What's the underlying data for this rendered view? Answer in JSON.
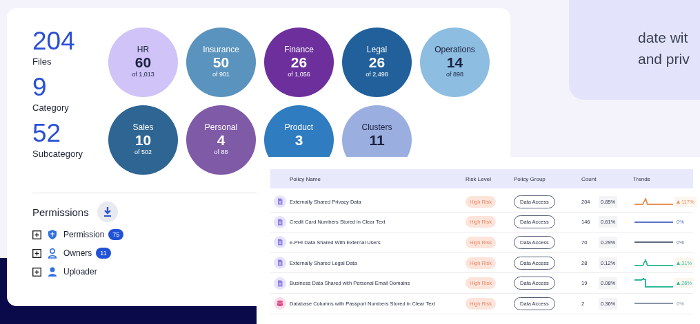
{
  "summary": {
    "stats": [
      {
        "value": "204",
        "label": "Files"
      },
      {
        "value": "9",
        "label": "Category"
      },
      {
        "value": "52",
        "label": "Subcategory"
      }
    ],
    "categories": [
      {
        "name": "HR",
        "count": "60",
        "of": "of 1,013",
        "color": "#cfc3f7",
        "dark_text": true
      },
      {
        "name": "Insurance",
        "count": "50",
        "of": "of 901",
        "color": "#5a93bd",
        "dark_text": false
      },
      {
        "name": "Finance",
        "count": "26",
        "of": "of 1,056",
        "color": "#6d2f9c",
        "dark_text": false
      },
      {
        "name": "Legal",
        "count": "26",
        "of": "of 2,498",
        "color": "#21609a",
        "dark_text": false
      },
      {
        "name": "Operations",
        "count": "14",
        "of": "of 898",
        "color": "#8dbde0",
        "dark_text": true
      },
      {
        "name": "Sales",
        "count": "10",
        "of": "of 502",
        "color": "#2f6592",
        "dark_text": false
      },
      {
        "name": "Personal",
        "count": "4",
        "of": "of 88",
        "color": "#7f5aa6",
        "dark_text": false
      },
      {
        "name": "Product",
        "count": "3",
        "color": "#2f7cc0",
        "dark_text": false
      },
      {
        "name": "Clusters",
        "count": "11",
        "color": "#9aaee0",
        "dark_text": true
      }
    ]
  },
  "permissions": {
    "title": "Permissions",
    "items": [
      {
        "label": "Permission",
        "kind": "shield",
        "badge": "75",
        "expanded": false
      },
      {
        "label": "Owners",
        "kind": "person-outline",
        "badge": "11",
        "expanded": false
      },
      {
        "label": "Uploader",
        "kind": "person",
        "expanded": false
      }
    ]
  },
  "side_card": {
    "lines": [
      "date wit",
      "and priv"
    ]
  },
  "table": {
    "columns": [
      "Policy Name",
      "Risk Level",
      "Policy Group",
      "Count",
      "Trends"
    ],
    "rows": [
      {
        "kind": "document",
        "name": "Externally Shared Privacy Data",
        "risk": "High Risk",
        "group": "Data Access",
        "count": "204",
        "share": "0.85%",
        "rising": true,
        "change": "117%",
        "color": "#e8935a"
      },
      {
        "kind": "document",
        "name": "Credit Card Numbers Stored in Clear Text",
        "risk": "High Risk",
        "group": "Data Access",
        "count": "146",
        "share": "0.61%",
        "rising": false,
        "change": "0%",
        "color": "#5b74c8"
      },
      {
        "kind": "document",
        "name": "e-PHI Data Shared With External Users",
        "risk": "High Risk",
        "group": "Data Access",
        "count": "70",
        "share": "0.29%",
        "rising": false,
        "change": "0%",
        "color": "#5d6a80"
      },
      {
        "kind": "document",
        "name": "Externally Shared Legal Data",
        "risk": "High Risk",
        "group": "Data Access",
        "count": "28",
        "share": "0.12%",
        "rising": true,
        "change": "31%",
        "color": "#3cbf9a"
      },
      {
        "kind": "document",
        "name": "Business Data Shared with Personal Email Domains",
        "risk": "High Risk",
        "group": "Data Access",
        "count": "19",
        "share": "0.08%",
        "rising": true,
        "change": "26%",
        "color": "#2fb89a"
      },
      {
        "kind": "database",
        "name": "Database Columns with Passport Numbers Stored in Clear Text",
        "risk": "High Risk",
        "group": "Data Access",
        "count": "2",
        "share": "0.36%",
        "rising": false,
        "change": "0%",
        "color": "#8a93a8"
      }
    ]
  }
}
